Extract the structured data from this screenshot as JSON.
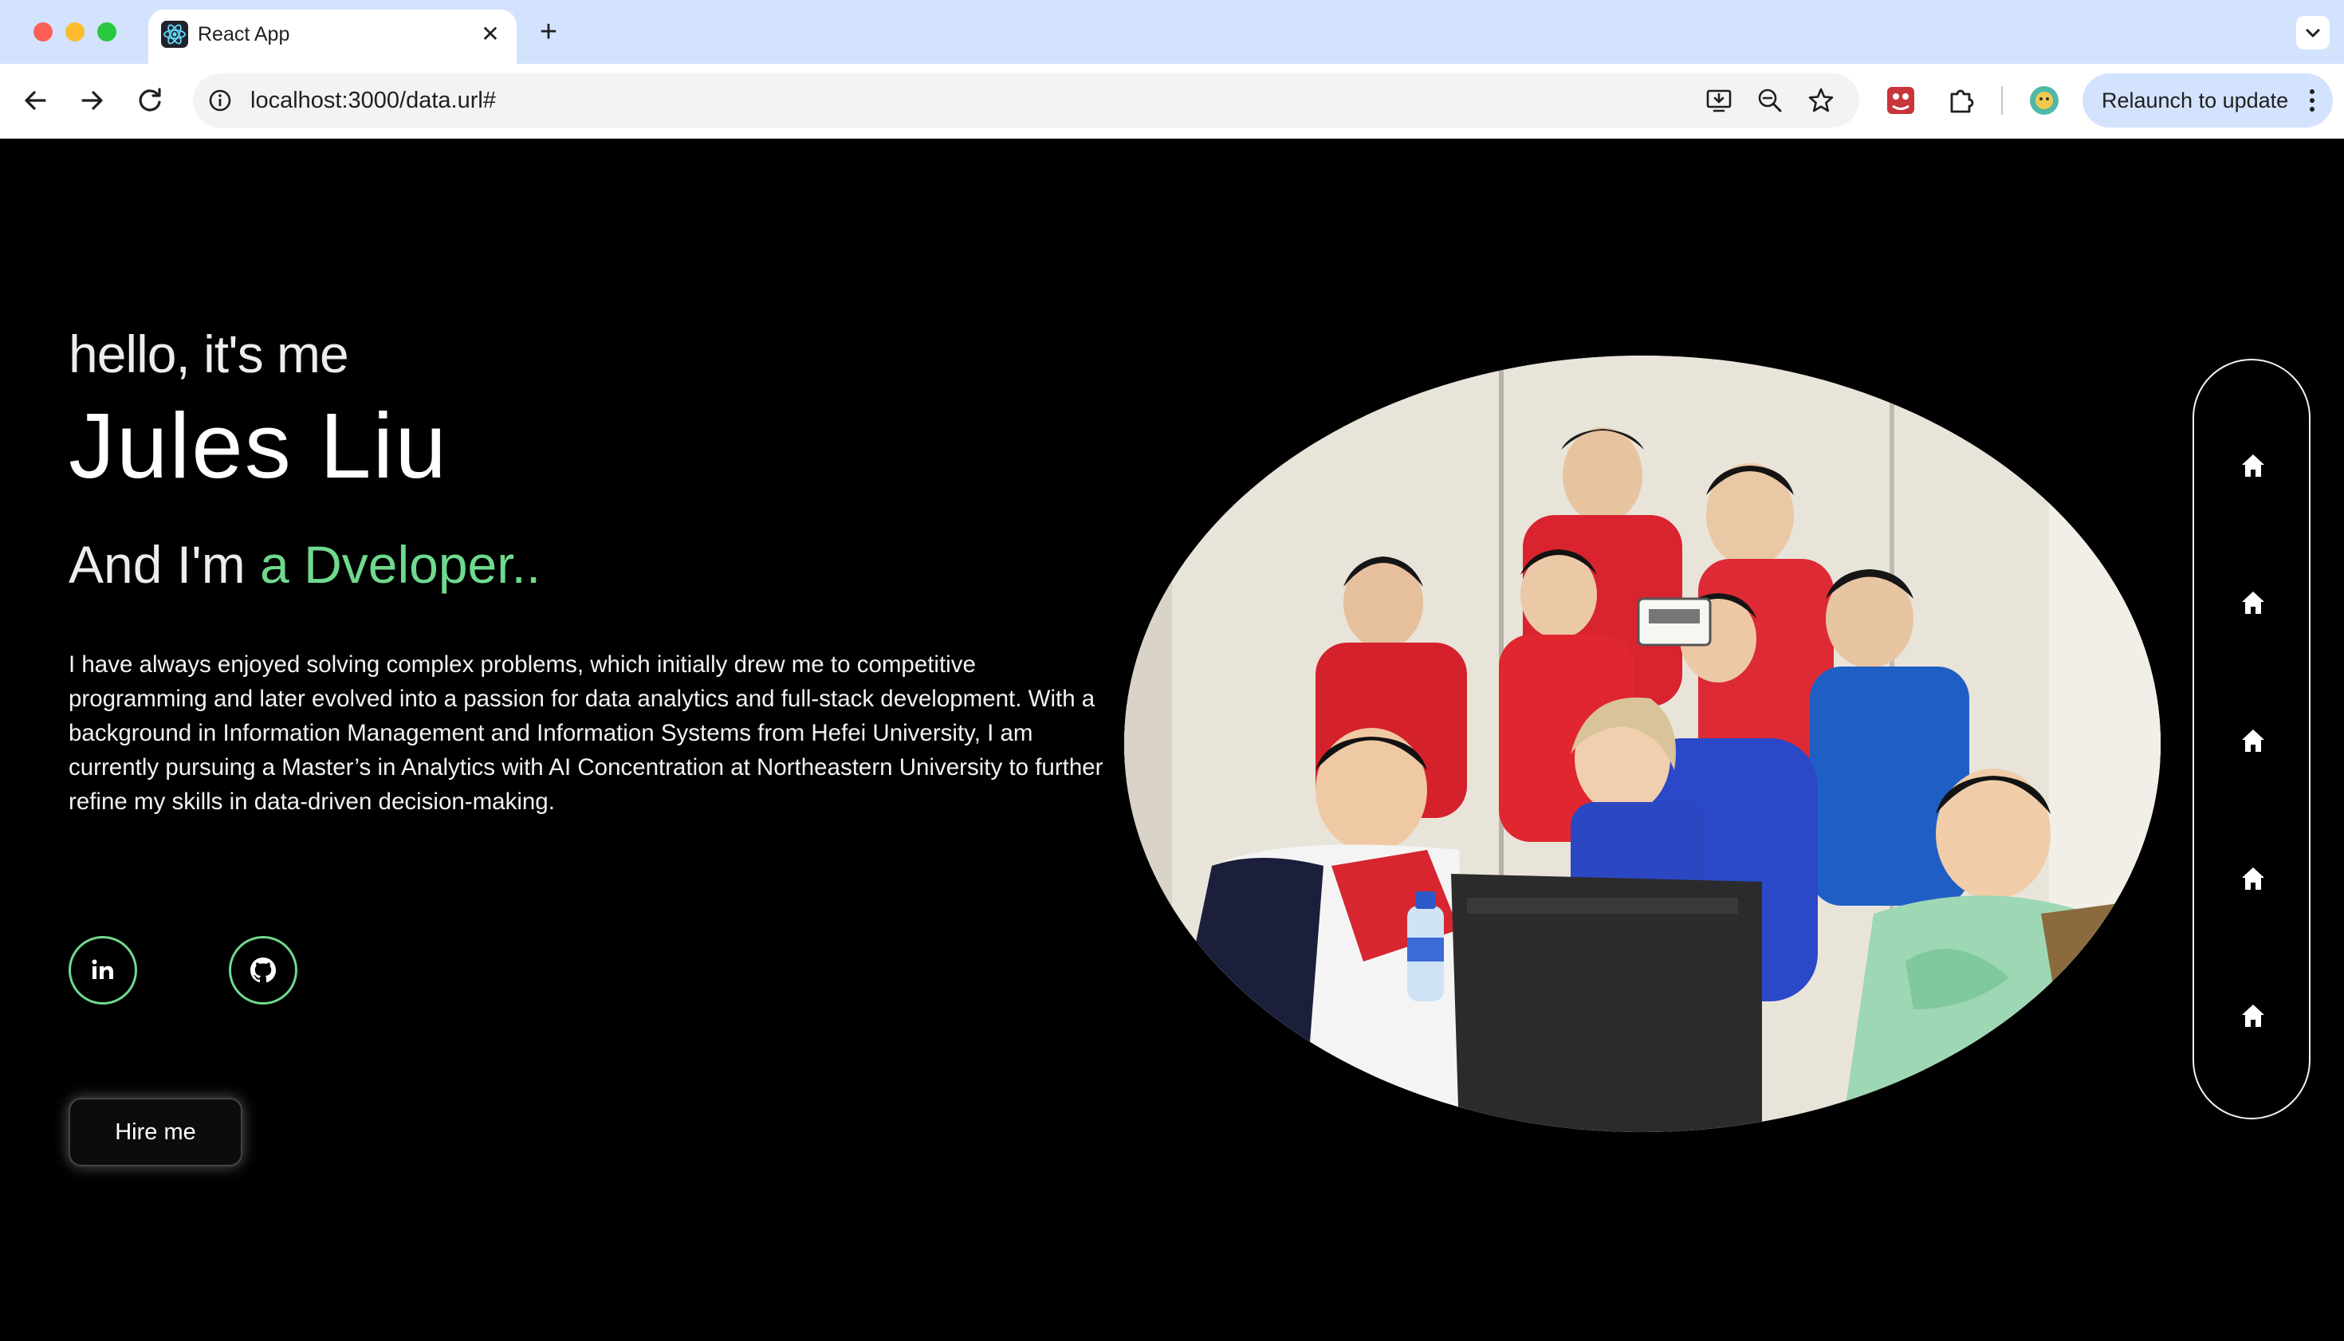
{
  "browser": {
    "tab_title": "React App",
    "url": "localhost:3000/data.url#",
    "relaunch_label": "Relaunch to update"
  },
  "hero": {
    "greeting": "hello, it's me",
    "name": "Jules Liu",
    "role_prefix": "And I'm",
    "role_accent": "a Dveloper..",
    "bio": "I have always enjoyed solving complex problems, which initially drew me to competitive programming and later evolved into a passion for data analytics and full-stack development. With a background in Information Management and Information Systems from Hefei University, I am currently pursuing a Master’s in Analytics with AI Concentration at Northeastern University to further refine my skills in data-driven decision-making.",
    "hire_label": "Hire me"
  },
  "social": [
    {
      "icon": "linkedin-icon"
    },
    {
      "icon": "github-icon"
    }
  ],
  "side_nav": [
    {
      "icon": "home-icon"
    },
    {
      "icon": "home-icon"
    },
    {
      "icon": "home-icon"
    },
    {
      "icon": "home-icon"
    },
    {
      "icon": "home-icon"
    }
  ],
  "colors": {
    "accent": "#6fd98e",
    "background": "#000000",
    "chrome_tabstrip": "#d3e3fd"
  }
}
